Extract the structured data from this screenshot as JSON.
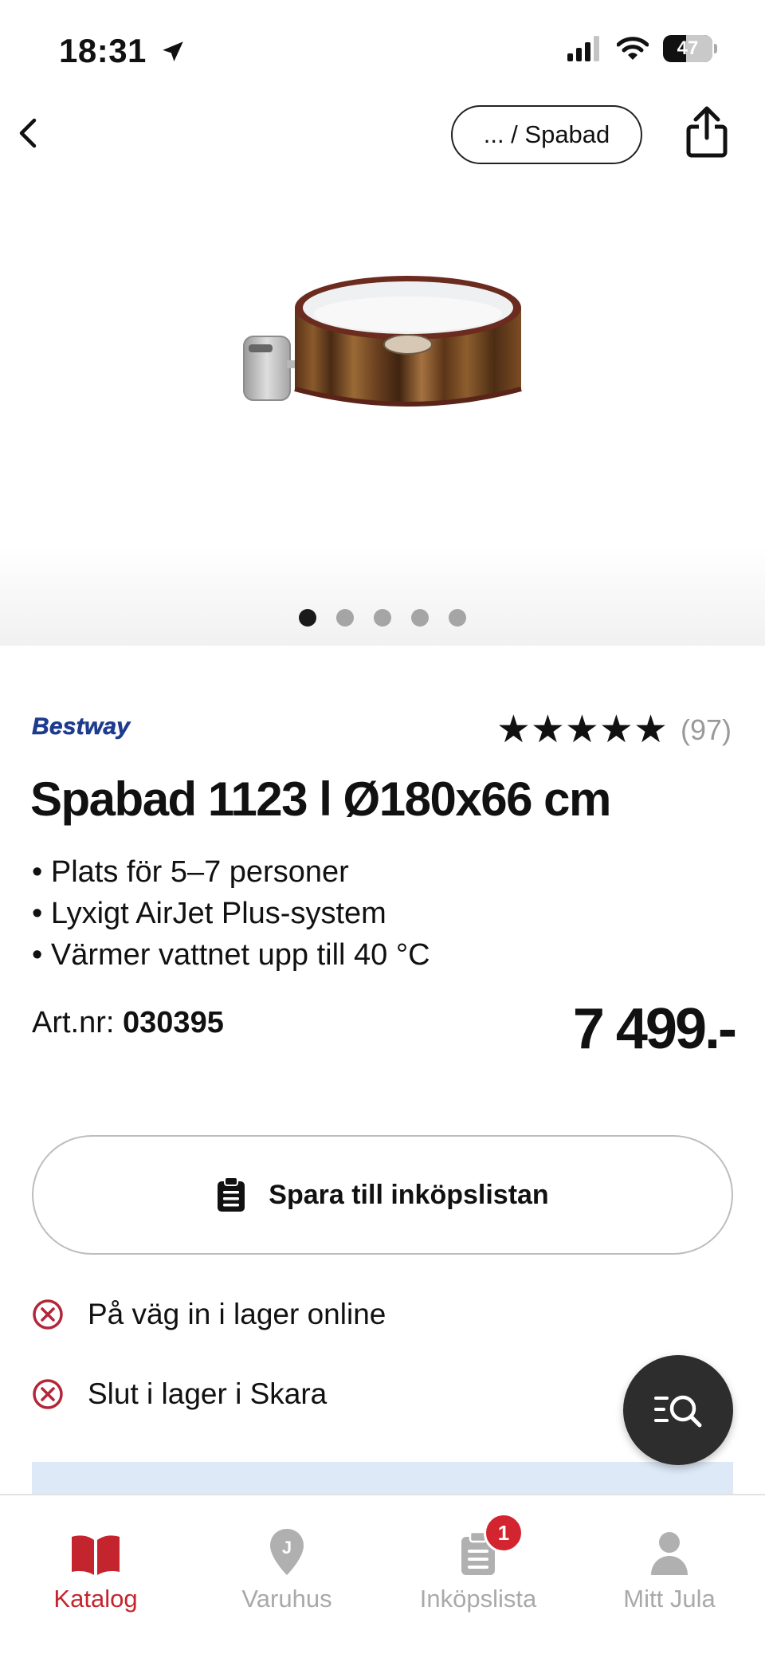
{
  "status_bar": {
    "time": "18:31",
    "battery": "47"
  },
  "nav": {
    "breadcrumb": "... / Spabad"
  },
  "gallery": {
    "image_count": 5,
    "active_index": 0
  },
  "product": {
    "brand": "Bestway",
    "rating_stars": "★★★★★",
    "rating_count": "(97)",
    "title": "Spabad 1123 l Ø180x66 cm",
    "features": [
      "Plats för 5–7 personer",
      "Lyxigt AirJet Plus-system",
      "Värmer vattnet upp till 40 °C"
    ],
    "art_label": "Art.nr:",
    "art_number": "030395",
    "price": "7 499.-"
  },
  "actions": {
    "save_label": "Spara till inköpslistan"
  },
  "stock": [
    {
      "text": "På väg in i lager online"
    },
    {
      "text": "Slut i lager i Skara"
    }
  ],
  "tabbar": {
    "items": [
      {
        "label": "Katalog",
        "active": true
      },
      {
        "label": "Varuhus",
        "active": false
      },
      {
        "label": "Inköpslista",
        "active": false,
        "badge": "1"
      },
      {
        "label": "Mitt Jula",
        "active": false
      }
    ]
  },
  "colors": {
    "accent": "#c4242d",
    "brand_blue": "#1d3b8f",
    "fab": "#2d2d2d",
    "info_bg": "#dde9f7"
  }
}
